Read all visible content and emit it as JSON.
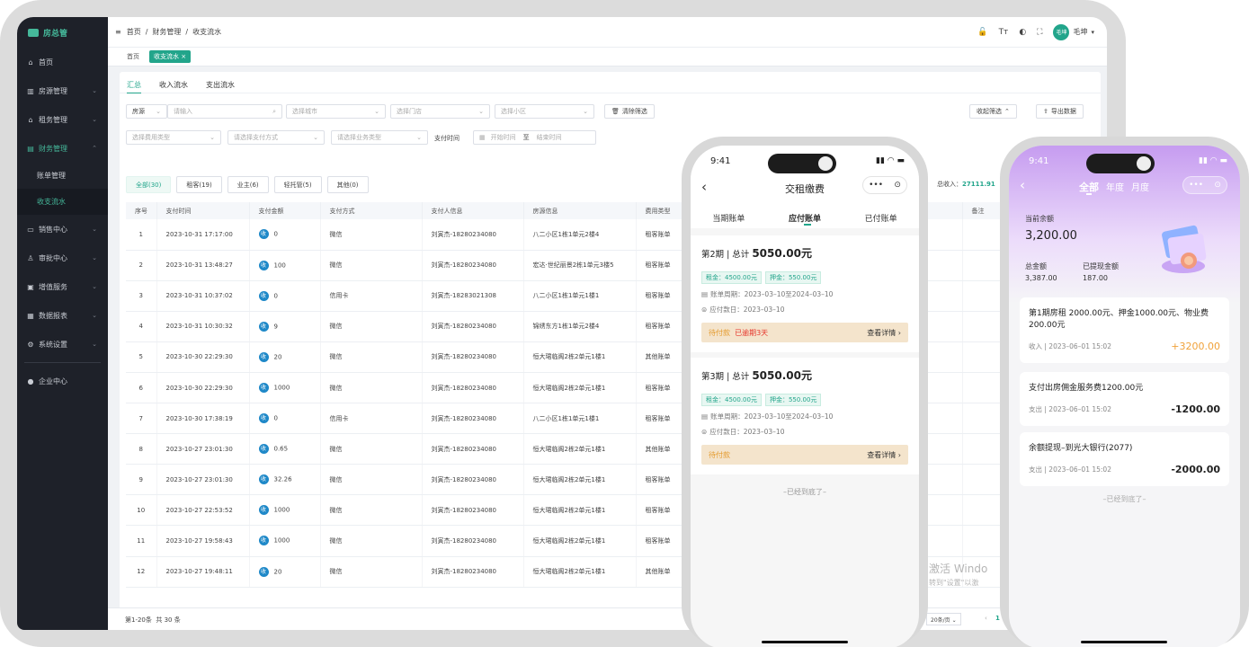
{
  "sidebar": {
    "brand": "房总管",
    "items": [
      {
        "label": "首页",
        "icon": "home-icon"
      },
      {
        "label": "房源管理",
        "icon": "building-icon"
      },
      {
        "label": "租务管理",
        "icon": "house-icon"
      },
      {
        "label": "财务管理",
        "icon": "finance-icon"
      },
      {
        "label": "销售中心",
        "icon": "sales-icon"
      },
      {
        "label": "审批中心",
        "icon": "approval-icon"
      },
      {
        "label": "增值服务",
        "icon": "gift-icon"
      },
      {
        "label": "数据报表",
        "icon": "chart-icon"
      },
      {
        "label": "系统设置",
        "icon": "gear-icon"
      },
      {
        "label": "企业中心",
        "icon": "enterprise-icon"
      }
    ],
    "subitems": [
      "账单管理",
      "收支流水"
    ]
  },
  "topbar": {
    "breadcrumb": [
      "首页",
      "财务管理",
      "收支流水"
    ],
    "user": "毛坤",
    "avatar_text": "毛坤"
  },
  "tabs": {
    "home": "首页",
    "current": "收支流水 ×"
  },
  "subtabs": [
    "汇总",
    "收入流水",
    "支出流水"
  ],
  "filters": {
    "source": "房源",
    "input_placeholder": "请输入",
    "city": "选择城市",
    "store": "选择门店",
    "community": "选择小区",
    "clear": "清除筛选",
    "collapse": "收起筛选",
    "export": "导出数据",
    "fee_type": "选择费用类型",
    "pay_method": "请选择支付方式",
    "biz_type": "请选择业务类型",
    "pay_time_label": "支付时间",
    "start": "开始时间",
    "to": "至",
    "end": "结束时间",
    "total_income_label": "总收入：",
    "total_income": "27111.91"
  },
  "pills": [
    "全部(30)",
    "租客(19)",
    "业主(6)",
    "轻托管(5)",
    "其他(0)"
  ],
  "table": {
    "headers": [
      "序号",
      "支付时间",
      "支付金额",
      "支付方式",
      "支付人信息",
      "房源信息",
      "费用类型",
      "备注"
    ],
    "rows": [
      [
        "1",
        "2023-10-31 17:17:00",
        "0",
        "微信",
        "刘寅杰-18280234080",
        "八二小区1栋1单元2楼4",
        "租客账单"
      ],
      [
        "2",
        "2023-10-31 13:48:27",
        "100",
        "微信",
        "刘寅杰-18280234080",
        "宏达·世纪丽景2栋1单元3楼5",
        "租客账单"
      ],
      [
        "3",
        "2023-10-31 10:37:02",
        "0",
        "信用卡",
        "刘寅杰-18283021308",
        "八二小区1栋1单元1楼1",
        "租客账单"
      ],
      [
        "4",
        "2023-10-31 10:30:32",
        "9",
        "微信",
        "刘寅杰-18280234080",
        "锦绣东方1栋1单元2楼4",
        "租客账单"
      ],
      [
        "5",
        "2023-10-30 22:29:30",
        "20",
        "微信",
        "刘寅杰-18280234080",
        "恒大珺临阁2栋2单元1楼1",
        "其他账单"
      ],
      [
        "6",
        "2023-10-30 22:29:30",
        "1000",
        "微信",
        "刘寅杰-18280234080",
        "恒大珺临阁2栋2单元1楼1",
        "租客账单"
      ],
      [
        "7",
        "2023-10-30 17:38:19",
        "0",
        "信用卡",
        "刘寅杰-18280234080",
        "八二小区1栋1单元1楼1",
        "租客账单"
      ],
      [
        "8",
        "2023-10-27 23:01:30",
        "0.65",
        "微信",
        "刘寅杰-18280234080",
        "恒大珺临阁2栋2单元1楼1",
        "其他账单"
      ],
      [
        "9",
        "2023-10-27 23:01:30",
        "32.26",
        "微信",
        "刘寅杰-18280234080",
        "恒大珺临阁2栋2单元1楼1",
        "租客账单"
      ],
      [
        "10",
        "2023-10-27 22:53:52",
        "1000",
        "微信",
        "刘寅杰-18280234080",
        "恒大珺临阁2栋2单元1楼1",
        "租客账单"
      ],
      [
        "11",
        "2023-10-27 19:58:43",
        "1000",
        "微信",
        "刘寅杰-18280234080",
        "恒大珺临阁2栋2单元1楼1",
        "租客账单"
      ],
      [
        "12",
        "2023-10-27 19:48:11",
        "20",
        "微信",
        "刘寅杰-18280234080",
        "恒大珺临阁2栋2单元1楼1",
        "其他账单"
      ]
    ]
  },
  "footer": {
    "range": "第1-20条",
    "total": "共 30 条",
    "page_size": "20条/页",
    "page": "1"
  },
  "watermark": {
    "line1": "激活 Windo",
    "line2": "转到\"设置\"以激"
  },
  "phone1": {
    "time": "9:41",
    "title": "交租缴费",
    "tabs": [
      "当期账单",
      "应付账单",
      "已付账单"
    ],
    "bills": [
      {
        "period": "第2期 | 总计 ",
        "amount": "5050.00元",
        "rent": "租金：4500.00元",
        "deposit": "押金：550.00元",
        "cycle": "账单周期：2023–03–10至2024–03–10",
        "due": "应付款日：2023–03–10",
        "status": "待付款",
        "overdue": "已逾期3天",
        "detail": "查看详情"
      },
      {
        "period": "第3期 | 总计 ",
        "amount": "5050.00元",
        "rent": "租金：4500.00元",
        "deposit": "押金：550.00元",
        "cycle": "账单周期：2023–03–10至2024–03–10",
        "due": "应付款日：2023–03–10",
        "status": "待付款",
        "overdue": "",
        "detail": "查看详情"
      }
    ],
    "end": "–已经到底了–"
  },
  "phone2": {
    "time": "9:41",
    "tabs": [
      "全部",
      "年度",
      "月度"
    ],
    "balance_label": "当前余额",
    "balance": "3,200.00",
    "total_label": "总金额",
    "total": "3,387.00",
    "withdrawn_label": "已提现金额",
    "withdrawn": "187.00",
    "records": [
      {
        "title": "第1期房租 2000.00元、押金1000.00元、物业费 200.00元",
        "meta": "收入 | 2023–06–01 15:02",
        "amount": "+3200.00",
        "color": "#f0a23a"
      },
      {
        "title": "支付出房佣金服务费1200.00元",
        "meta": "支出 | 2023–06–01 15:02",
        "amount": "-1200.00",
        "color": "#222222"
      },
      {
        "title": "余额提现–到光大银行(2077)",
        "meta": "支出 | 2023–06–01 15:02",
        "amount": "-2000.00",
        "color": "#222222"
      }
    ],
    "end": "–已经到底了–"
  },
  "colors": {
    "accent": "#22a58b",
    "sidebar": "#1e2129",
    "purple": "#c69cf0"
  }
}
